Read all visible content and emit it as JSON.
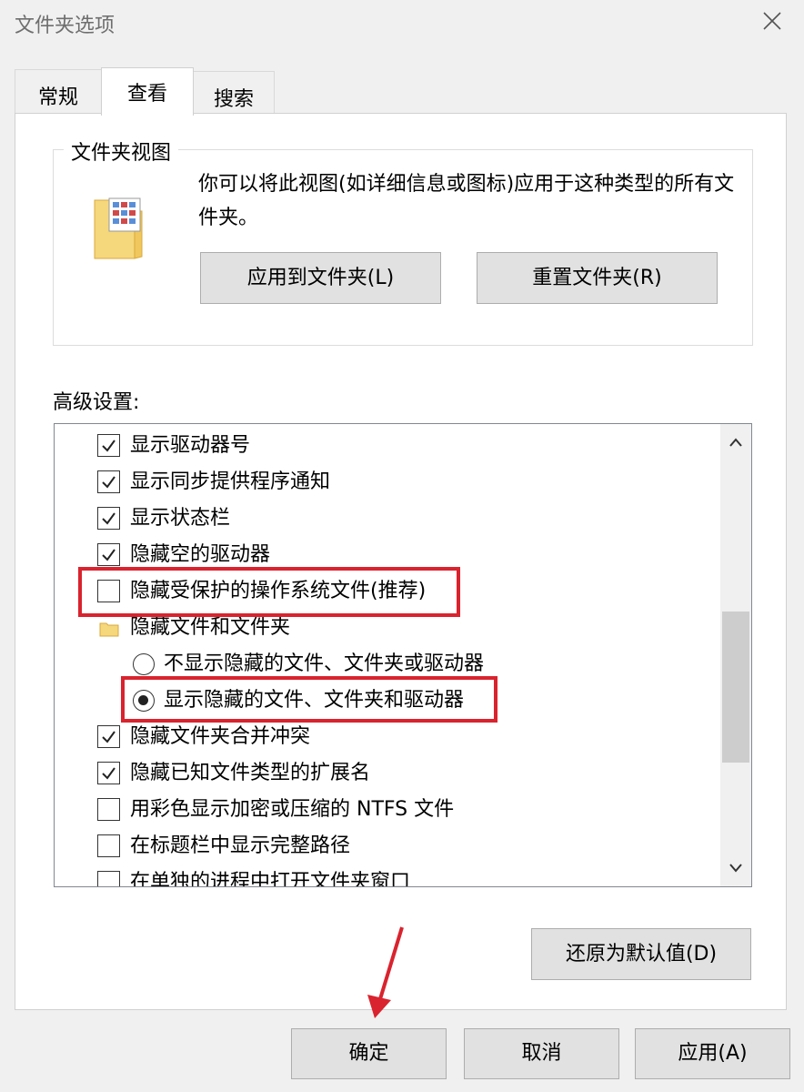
{
  "window": {
    "title": "文件夹选项",
    "close_icon": "close-icon"
  },
  "tabs": [
    {
      "label": "常规",
      "active": false
    },
    {
      "label": "查看",
      "active": true
    },
    {
      "label": "搜索",
      "active": false
    }
  ],
  "folder_views": {
    "legend": "文件夹视图",
    "description": "你可以将此视图(如详细信息或图标)应用于这种类型的所有文件夹。",
    "apply_button": "应用到文件夹(L)",
    "reset_button": "重置文件夹(R)"
  },
  "advanced": {
    "label": "高级设置:",
    "items": [
      {
        "type": "checkbox",
        "checked": true,
        "label": "显示驱动器号"
      },
      {
        "type": "checkbox",
        "checked": true,
        "label": "显示同步提供程序通知"
      },
      {
        "type": "checkbox",
        "checked": true,
        "label": "显示状态栏"
      },
      {
        "type": "checkbox",
        "checked": true,
        "label": "隐藏空的驱动器"
      },
      {
        "type": "checkbox",
        "checked": false,
        "label": "隐藏受保护的操作系统文件(推荐)"
      },
      {
        "type": "folder",
        "label": "隐藏文件和文件夹"
      },
      {
        "type": "radio",
        "checked": false,
        "label": "不显示隐藏的文件、文件夹或驱动器"
      },
      {
        "type": "radio",
        "checked": true,
        "label": "显示隐藏的文件、文件夹和驱动器"
      },
      {
        "type": "checkbox",
        "checked": true,
        "label": "隐藏文件夹合并冲突"
      },
      {
        "type": "checkbox",
        "checked": true,
        "label": "隐藏已知文件类型的扩展名"
      },
      {
        "type": "checkbox",
        "checked": false,
        "label": "用彩色显示加密或压缩的 NTFS 文件"
      },
      {
        "type": "checkbox",
        "checked": false,
        "label": "在标题栏中显示完整路径"
      },
      {
        "type": "checkbox",
        "checked": false,
        "label": "在单独的进程中打开文件夹窗口"
      }
    ],
    "restore_button": "还原为默认值(D)"
  },
  "footer": {
    "ok": "确定",
    "cancel": "取消",
    "apply": "应用(A)"
  },
  "colors": {
    "highlight": "#d9232e",
    "folder": "#f5d77c"
  }
}
